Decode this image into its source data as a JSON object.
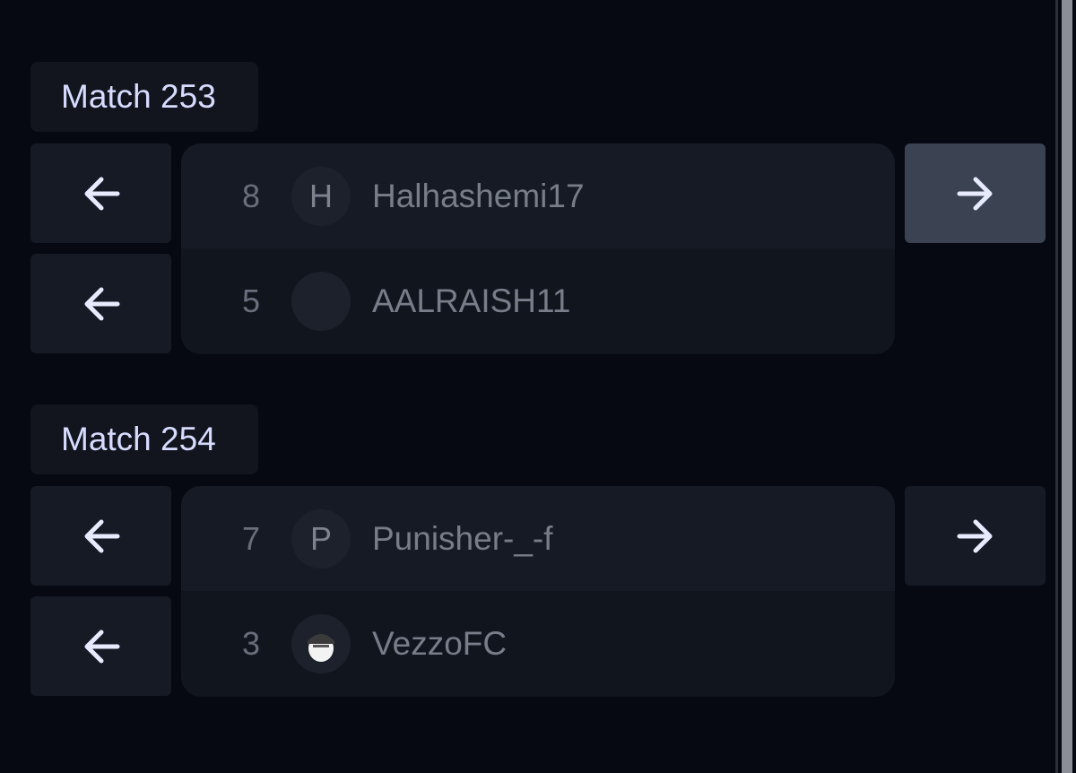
{
  "matches": [
    {
      "label": "Match 253",
      "players": [
        {
          "score": "8",
          "avatar_initial": "H",
          "name": "Halhashemi17"
        },
        {
          "score": "5",
          "avatar_initial": "",
          "name": "AALRAISH11"
        }
      ]
    },
    {
      "label": "Match 254",
      "players": [
        {
          "score": "7",
          "avatar_initial": "P",
          "name": "Punisher-_-f"
        },
        {
          "score": "3",
          "avatar_initial": "",
          "name": "VezzoFC"
        }
      ]
    }
  ],
  "icons": {
    "left": "arrow-left-icon",
    "right": "arrow-right-icon"
  },
  "colors": {
    "background": "#060912",
    "label_text": "#d7dcff",
    "active_button": "#3b4252"
  }
}
